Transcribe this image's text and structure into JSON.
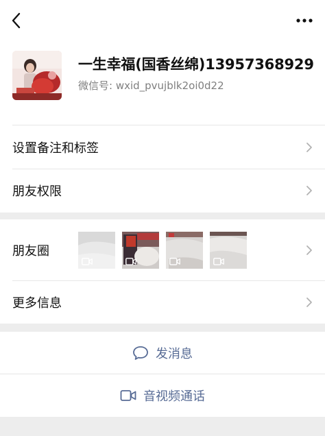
{
  "header": {
    "back_icon": "chevron-left-icon",
    "more_icon": "more-dots-icon"
  },
  "profile": {
    "name": "一生幸福(国香丝绵)13957368929",
    "wxid": "微信号:  wxid_pvujblk2oi0d22"
  },
  "menu": {
    "remark_label": "设置备注和标签",
    "permissions_label": "朋友权限",
    "moments_label": "朋友圈",
    "more_info_label": "更多信息"
  },
  "moments": {
    "thumbnails": [
      {
        "icon": "video-camera-icon"
      },
      {
        "icon": "video-camera-icon"
      },
      {
        "icon": "video-camera-icon"
      },
      {
        "icon": "video-camera-icon"
      }
    ]
  },
  "actions": {
    "message_label": "发消息",
    "call_label": "音视频通话"
  },
  "colors": {
    "link_blue": "#576b95",
    "background": "#ededed",
    "secondary_text": "#7f7f7f"
  }
}
